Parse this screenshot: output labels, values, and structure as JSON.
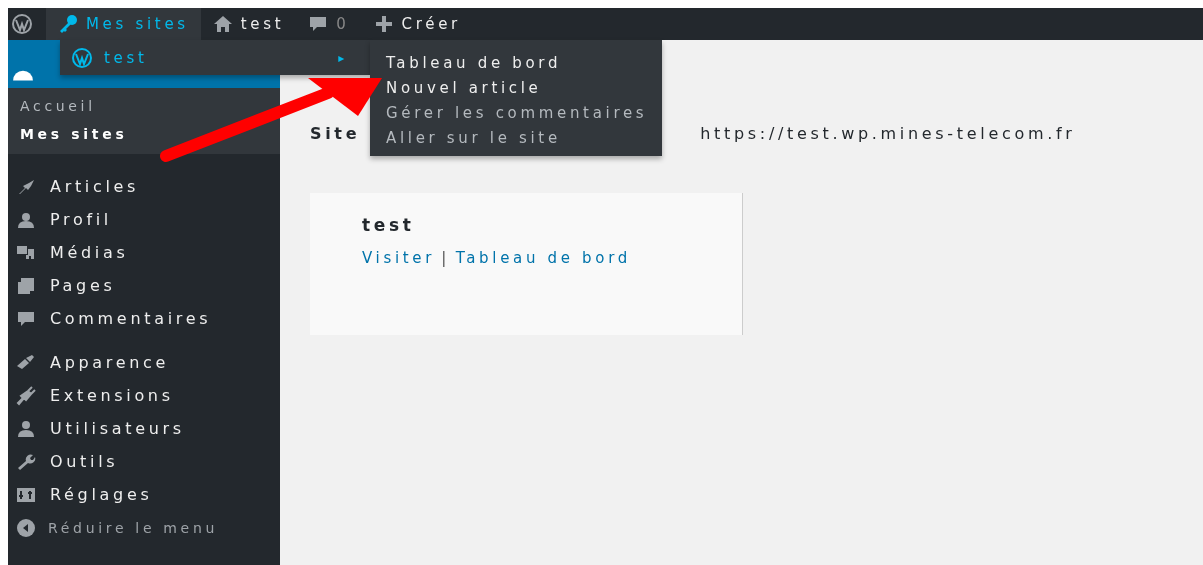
{
  "admin_bar": {
    "items": [
      {
        "kind": "logo"
      },
      {
        "kind": "sites",
        "label": "Mes sites",
        "expanded": true
      },
      {
        "kind": "home",
        "label": "test"
      },
      {
        "kind": "comments",
        "label": "0"
      },
      {
        "kind": "new",
        "label": "Créer"
      }
    ]
  },
  "sites_menu": {
    "site": {
      "label": "test",
      "arrow": "▸"
    },
    "submenu": [
      "Tableau de bord",
      "Nouvel article",
      "Gérer les commentaires",
      "Aller sur le site"
    ]
  },
  "sidebar": {
    "dashboard_submenu": [
      {
        "label": "Accueil",
        "selected": false
      },
      {
        "label": "Mes sites",
        "selected": true
      }
    ],
    "groups": [
      {
        "items": [
          "Articles",
          "Profil",
          "Médias",
          "Pages",
          "Commentaires"
        ]
      },
      {
        "items": [
          "Apparence",
          "Extensions",
          "Utilisateurs",
          "Outils",
          "Réglages"
        ]
      }
    ],
    "collapse": "Réduire le menu"
  },
  "content": {
    "site_label": "Site",
    "site_url": "https://test.wp.mines-telecom.fr",
    "card": {
      "title": "test",
      "links": [
        "Visiter",
        "Tableau de bord"
      ],
      "separator": "|"
    }
  }
}
